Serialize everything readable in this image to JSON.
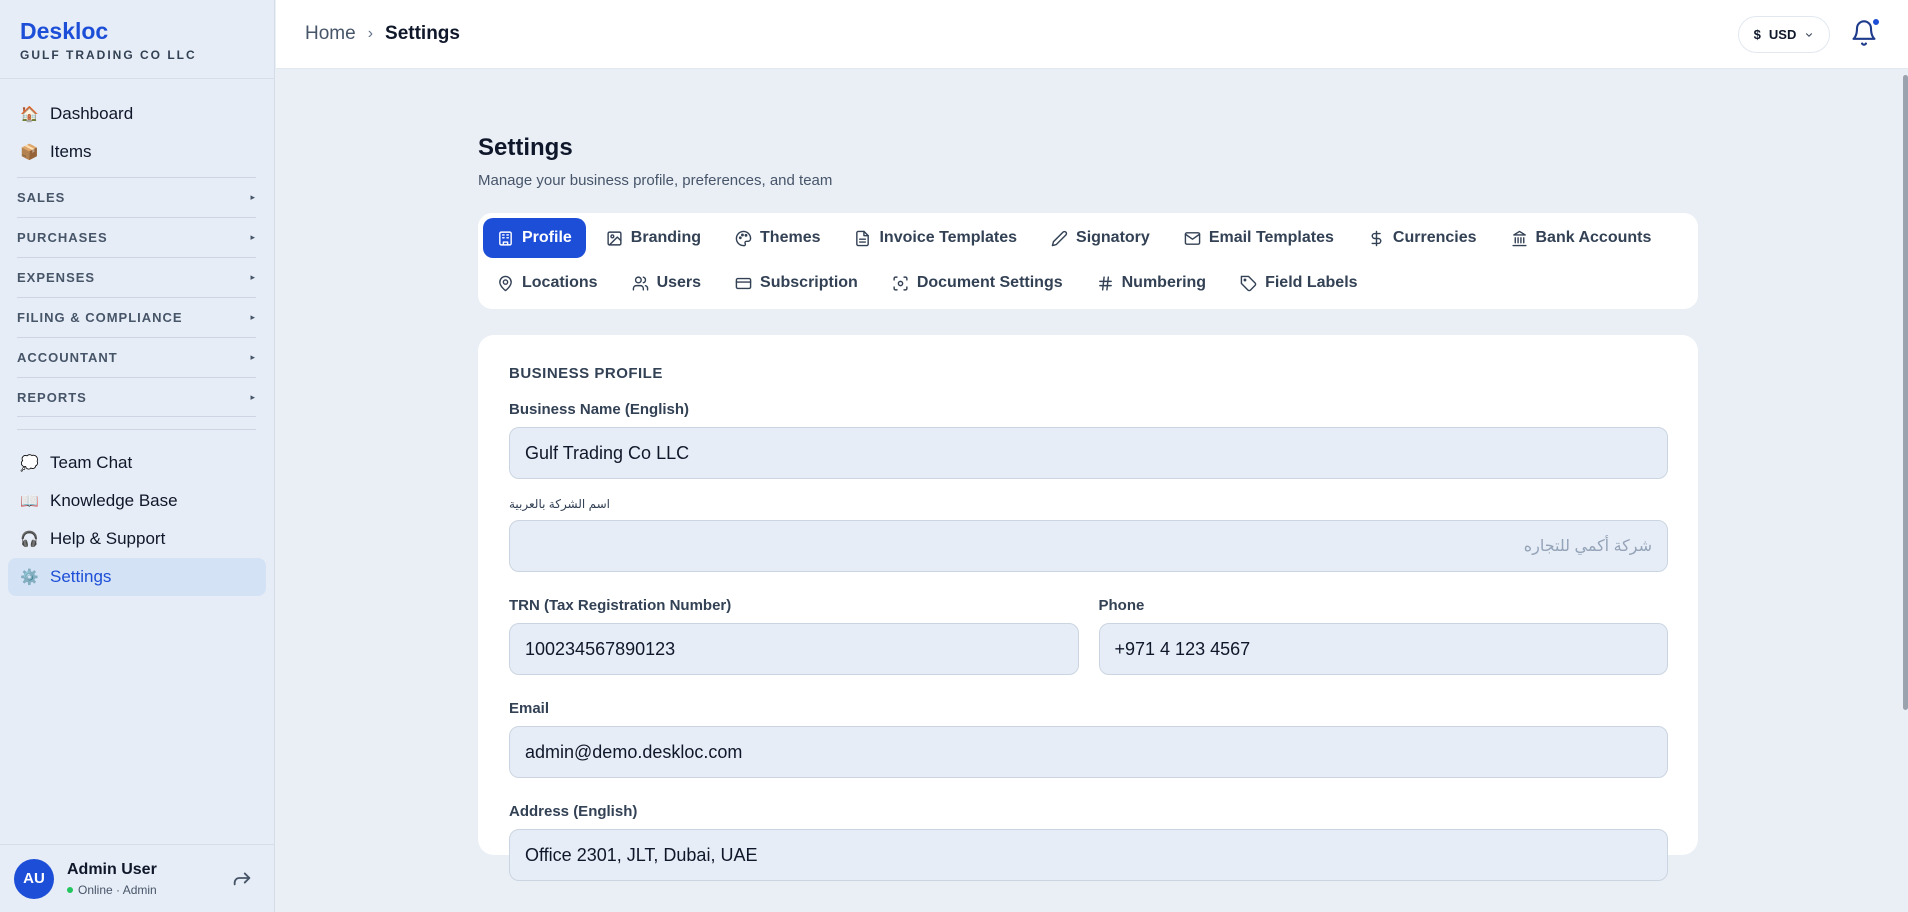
{
  "brand": {
    "name": "Deskloc",
    "subtitle": "GULF TRADING CO LLC"
  },
  "sidebar": {
    "top_items": [
      {
        "label": "Dashboard",
        "icon": "house-icon",
        "glyph": "🏠"
      },
      {
        "label": "Items",
        "icon": "package-icon",
        "glyph": "📦"
      }
    ],
    "sections": [
      {
        "label": "SALES"
      },
      {
        "label": "PURCHASES"
      },
      {
        "label": "EXPENSES"
      },
      {
        "label": "FILING & COMPLIANCE"
      },
      {
        "label": "ACCOUNTANT"
      },
      {
        "label": "REPORTS"
      }
    ],
    "bottom_items": [
      {
        "label": "Team Chat",
        "icon": "speech-bubble-icon",
        "glyph": "💭"
      },
      {
        "label": "Knowledge Base",
        "icon": "book-icon",
        "glyph": "📖"
      },
      {
        "label": "Help & Support",
        "icon": "headphones-icon",
        "glyph": "🎧"
      },
      {
        "label": "Settings",
        "icon": "gear-icon",
        "glyph": "⚙️",
        "active": true
      }
    ],
    "user": {
      "initials": "AU",
      "name": "Admin User",
      "status": "Online · Admin"
    }
  },
  "header": {
    "breadcrumb": {
      "home": "Home",
      "current": "Settings"
    },
    "currency": {
      "symbol": "$",
      "code": "USD"
    }
  },
  "page": {
    "title": "Settings",
    "subtitle": "Manage your business profile, preferences, and team"
  },
  "tabs": [
    {
      "label": "Profile",
      "icon": "building-icon",
      "active": true
    },
    {
      "label": "Branding",
      "icon": "image-icon"
    },
    {
      "label": "Themes",
      "icon": "palette-icon"
    },
    {
      "label": "Invoice Templates",
      "icon": "file-text-icon"
    },
    {
      "label": "Signatory",
      "icon": "pen-icon"
    },
    {
      "label": "Email Templates",
      "icon": "mail-icon"
    },
    {
      "label": "Currencies",
      "icon": "dollar-icon"
    },
    {
      "label": "Bank Accounts",
      "icon": "bank-icon"
    },
    {
      "label": "Locations",
      "icon": "map-pin-icon"
    },
    {
      "label": "Users",
      "icon": "users-icon"
    },
    {
      "label": "Subscription",
      "icon": "credit-card-icon"
    },
    {
      "label": "Document Settings",
      "icon": "scan-icon"
    },
    {
      "label": "Numbering",
      "icon": "hash-icon"
    },
    {
      "label": "Field Labels",
      "icon": "tag-icon"
    }
  ],
  "profile": {
    "section_title": "BUSINESS PROFILE",
    "business_name_en": {
      "label": "Business Name (English)",
      "value": "Gulf Trading Co LLC"
    },
    "business_name_ar": {
      "label": "اسم الشركة بالعربية",
      "placeholder": "شركة أكمي للتجاره"
    },
    "trn": {
      "label": "TRN (Tax Registration Number)",
      "value": "100234567890123"
    },
    "phone": {
      "label": "Phone",
      "value": "+971 4 123 4567"
    },
    "email": {
      "label": "Email",
      "value": "admin@demo.deskloc.com"
    },
    "address_en": {
      "label": "Address (English)",
      "value": "Office 2301, JLT, Dubai, UAE"
    }
  }
}
